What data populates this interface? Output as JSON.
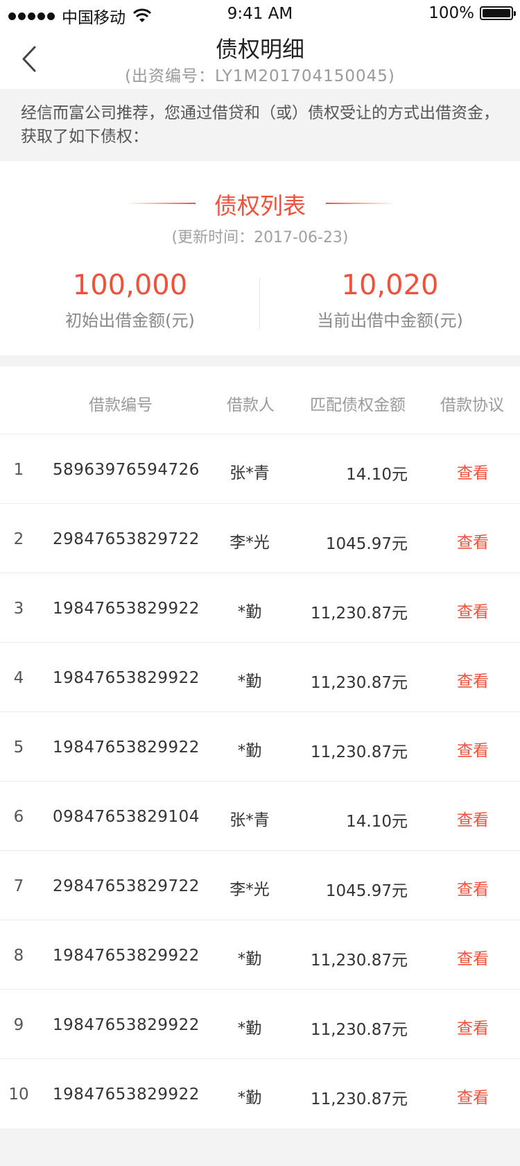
{
  "status_bar": {
    "carrier": "中国移动",
    "time": "9:41 AM",
    "battery": "100%"
  },
  "nav": {
    "title": "债权明细",
    "subtitle": "(出资编号：LY1M201704150045)"
  },
  "notice": "经信而富公司推荐，您通过借贷和（或）债权受让的方式出借资金，获取了如下债权：",
  "summary": {
    "title": "债权列表",
    "update_time": "(更新时间：2017-06-23)",
    "initial_amount": "100,000",
    "initial_label": "初始出借金额(元)",
    "current_amount": "10,020",
    "current_label": "当前出借中金额(元)"
  },
  "table": {
    "headers": {
      "loan_no": "借款编号",
      "borrower": "借款人",
      "amount": "匹配债权金额",
      "protocol": "借款协议"
    },
    "rows": [
      {
        "index": "1",
        "loan_no": "58963976594726",
        "borrower": "张*青",
        "amount": "14.10元",
        "action": "查看"
      },
      {
        "index": "2",
        "loan_no": "29847653829722",
        "borrower": "李*光",
        "amount": "1045.97元",
        "action": "查看"
      },
      {
        "index": "3",
        "loan_no": "19847653829922",
        "borrower": "*勤",
        "amount": "11,230.87元",
        "action": "查看"
      },
      {
        "index": "4",
        "loan_no": "19847653829922",
        "borrower": "*勤",
        "amount": "11,230.87元",
        "action": "查看"
      },
      {
        "index": "5",
        "loan_no": "19847653829922",
        "borrower": "*勤",
        "amount": "11,230.87元",
        "action": "查看"
      },
      {
        "index": "6",
        "loan_no": "09847653829104",
        "borrower": "张*青",
        "amount": "14.10元",
        "action": "查看"
      },
      {
        "index": "7",
        "loan_no": "29847653829722",
        "borrower": "李*光",
        "amount": "1045.97元",
        "action": "查看"
      },
      {
        "index": "8",
        "loan_no": "19847653829922",
        "borrower": "*勤",
        "amount": "11,230.87元",
        "action": "查看"
      },
      {
        "index": "9",
        "loan_no": "19847653829922",
        "borrower": "*勤",
        "amount": "11,230.87元",
        "action": "查看"
      },
      {
        "index": "10",
        "loan_no": "19847653829922",
        "borrower": "*勤",
        "amount": "11,230.87元",
        "action": "查看"
      }
    ]
  },
  "colors": {
    "accent": "#f0513c",
    "background": "#f3f3f3"
  }
}
